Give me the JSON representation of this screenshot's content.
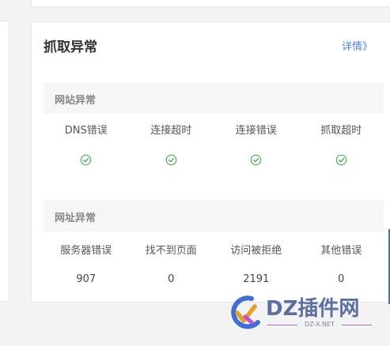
{
  "card": {
    "title": "抓取异常",
    "details_link": "详情》"
  },
  "site_section": {
    "header": "网站异常",
    "columns": [
      "DNS错误",
      "连接超时",
      "连接错误",
      "抓取超时"
    ],
    "statuses": [
      "ok",
      "ok",
      "ok",
      "ok"
    ]
  },
  "url_section": {
    "header": "网址异常",
    "columns": [
      "服务器错误",
      "找不到页面",
      "访问被拒绝",
      "其他错误"
    ],
    "values": [
      "907",
      "0",
      "2191",
      "0"
    ]
  },
  "watermark": {
    "brand": "DZ插件网",
    "domain": "DZ-X.NET"
  },
  "colors": {
    "link": "#4d7fd8",
    "check": "#46b05a",
    "header_bg": "#f6f6f6"
  }
}
